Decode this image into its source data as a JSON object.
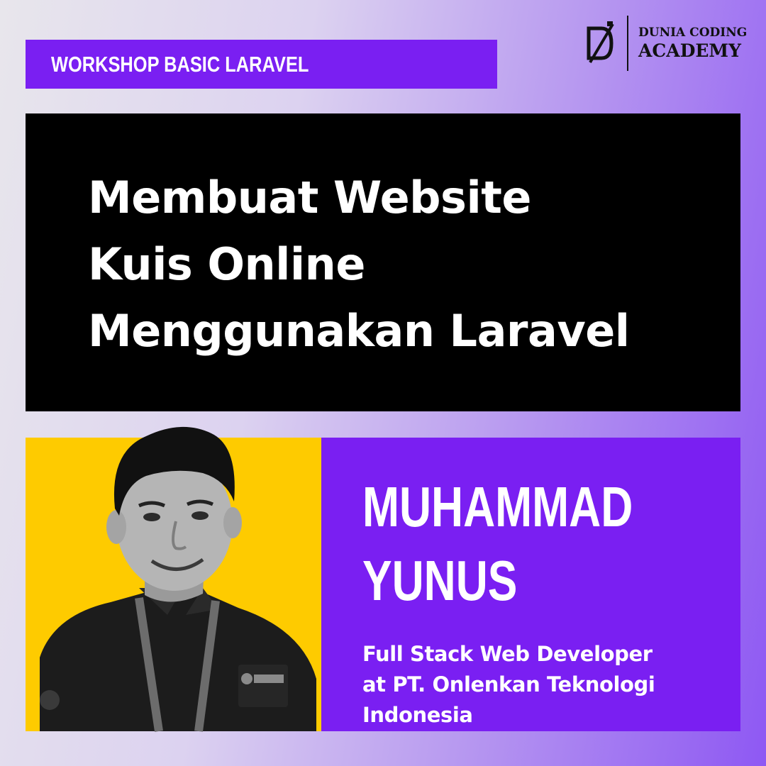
{
  "workshop": {
    "label": "WORKSHOP BASIC LARAVEL"
  },
  "brand": {
    "line1": "DUNIA CODING",
    "line2": "ACADEMY",
    "logo_icon": "dca-monogram-icon"
  },
  "title": {
    "lines": [
      "Membuat Website",
      "Kuis Online",
      "Menggunakan Laravel"
    ]
  },
  "speaker": {
    "name_lines": [
      "MUHAMMAD",
      "YUNUS"
    ],
    "role_lines": [
      "Full Stack Web Developer",
      "at PT. Onlenkan Teknologi",
      "Indonesia"
    ],
    "photo": "speaker-portrait"
  },
  "colors": {
    "accent_purple": "#7a1ff2",
    "photo_background_yellow": "#fecb00",
    "title_background": "#000000",
    "text_light": "#ffffff"
  }
}
